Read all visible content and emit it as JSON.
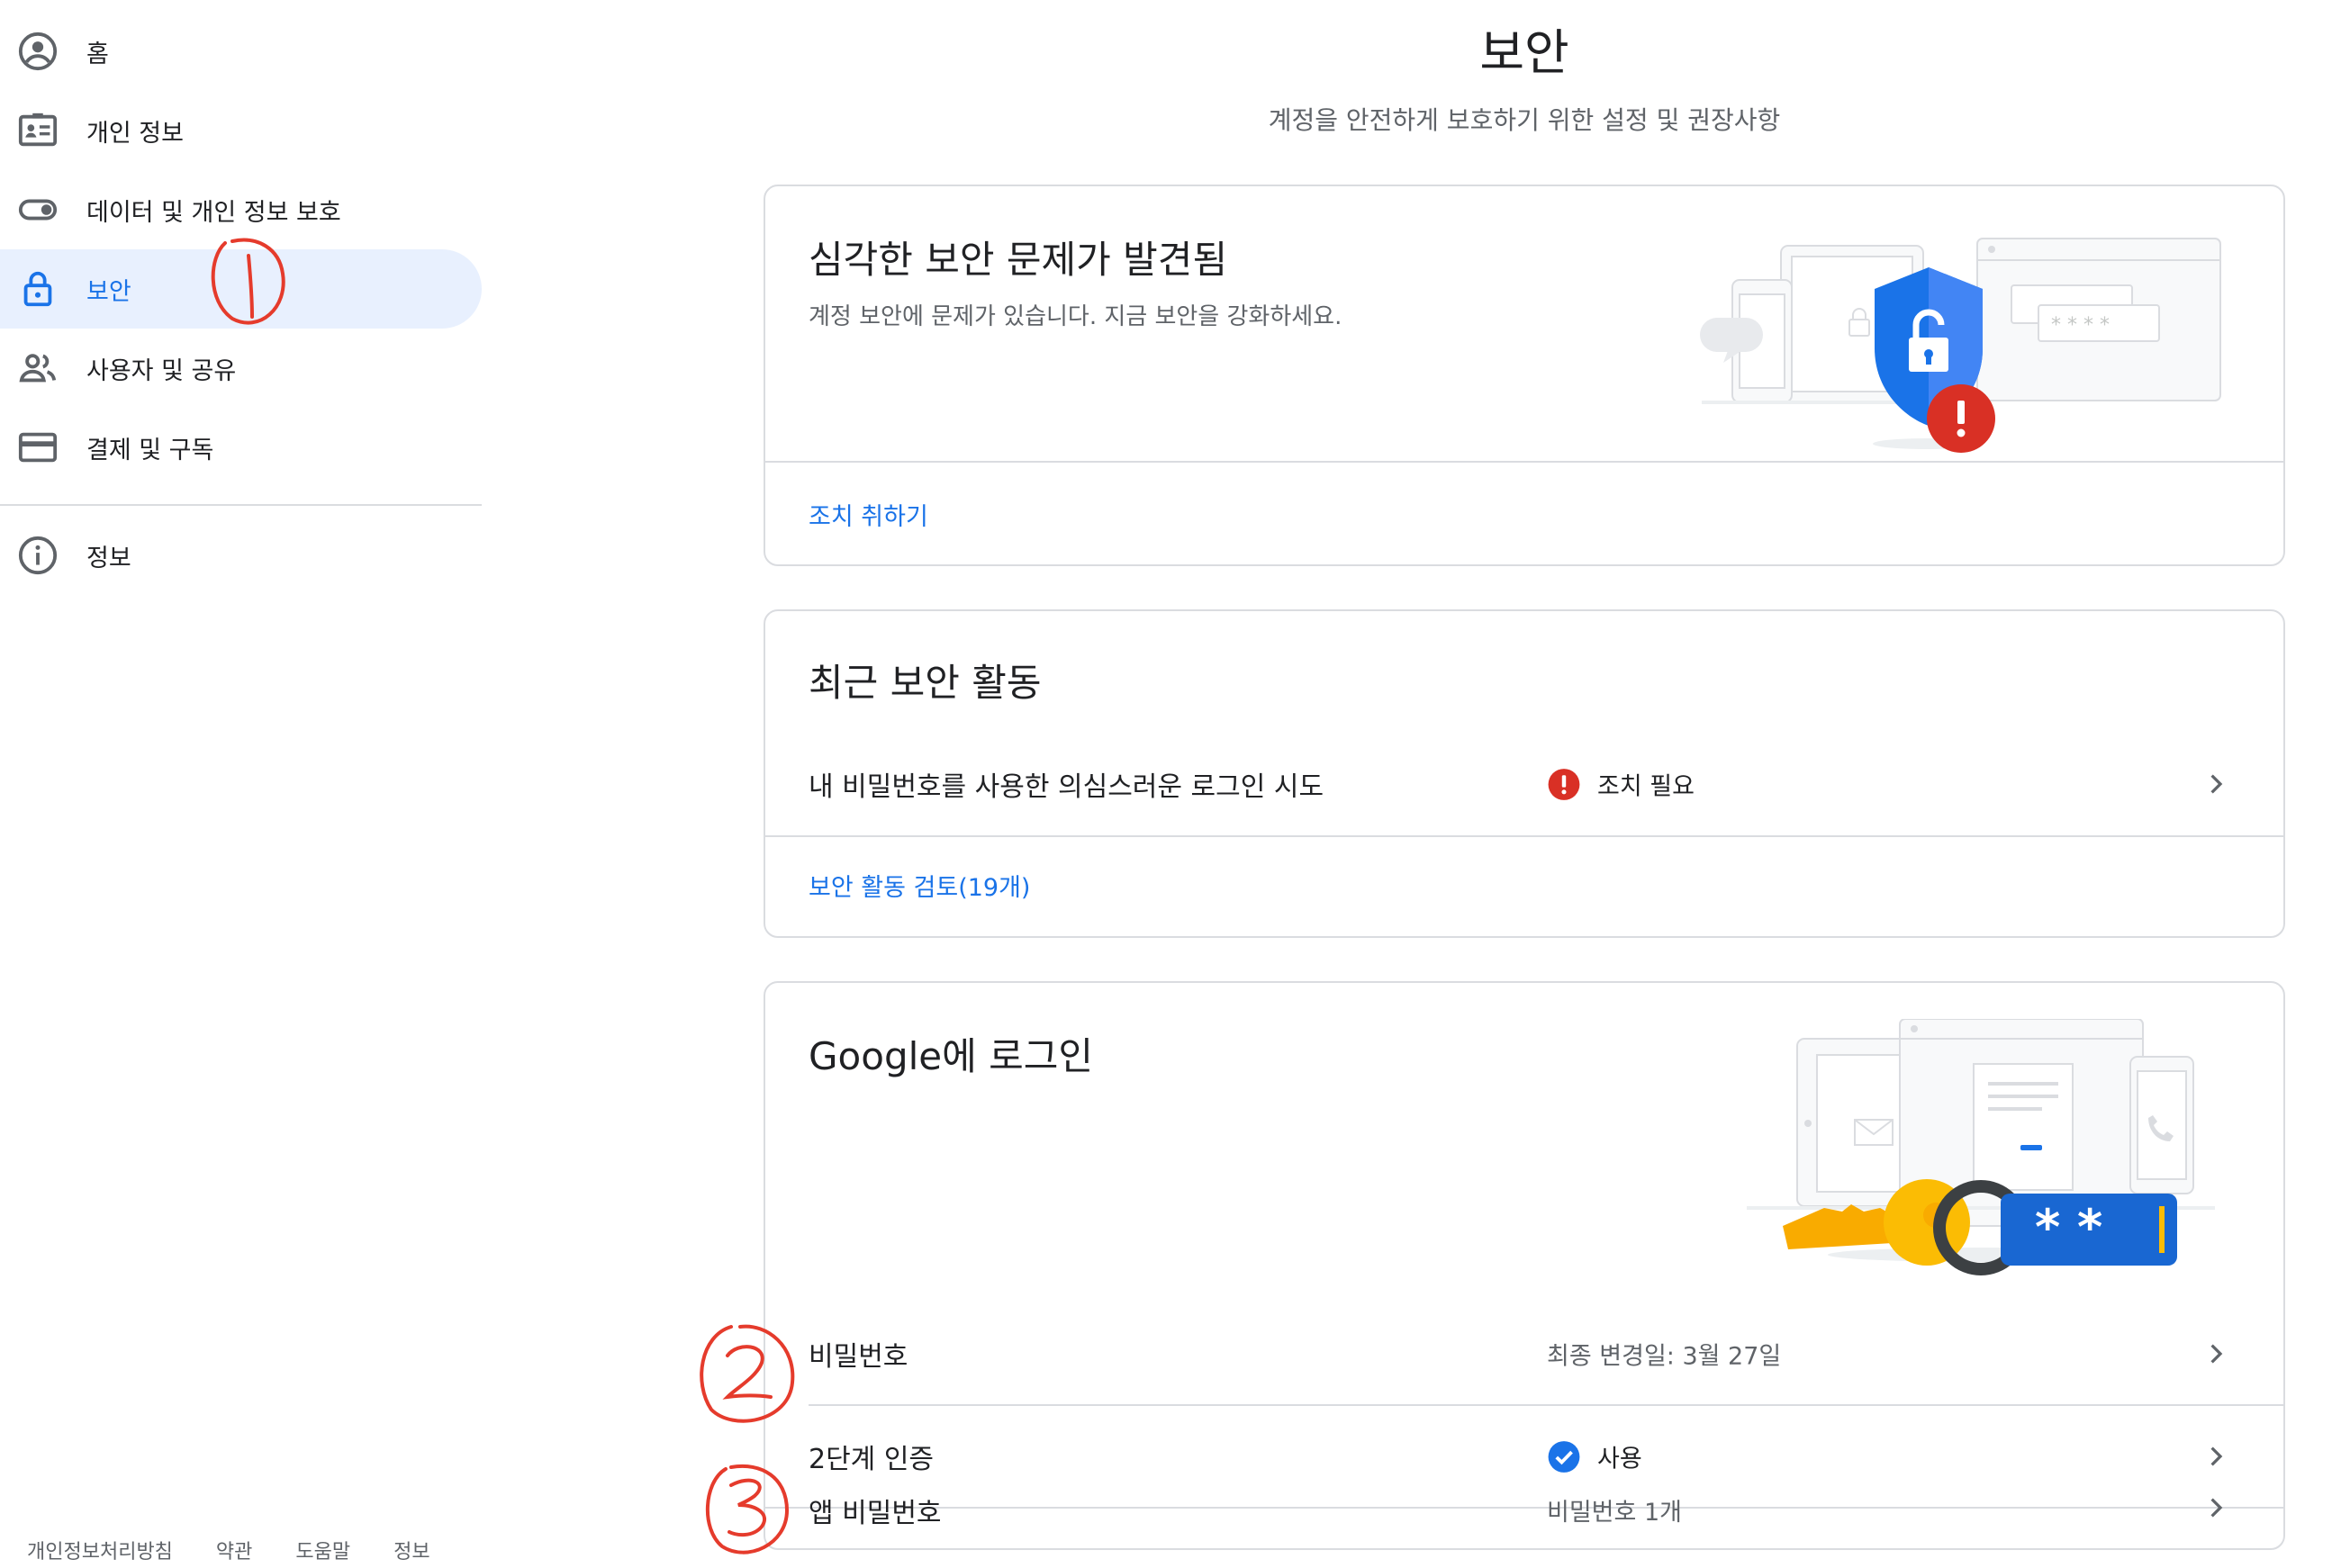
{
  "sidebar": {
    "items": [
      {
        "label": "홈",
        "icon": "account-circle-icon"
      },
      {
        "label": "개인 정보",
        "icon": "id-card-icon"
      },
      {
        "label": "데이터 및 개인 정보 보호",
        "icon": "toggle-icon"
      },
      {
        "label": "보안",
        "icon": "lock-icon",
        "active": true
      },
      {
        "label": "사용자 및 공유",
        "icon": "people-icon"
      },
      {
        "label": "결제 및 구독",
        "icon": "credit-card-icon"
      },
      {
        "label": "정보",
        "icon": "info-icon"
      }
    ]
  },
  "footer": {
    "privacy": "개인정보처리방침",
    "terms": "약관",
    "help": "도움말",
    "about": "정보"
  },
  "header": {
    "title": "보안",
    "subtitle": "계정을 안전하게 보호하기 위한 설정 및 권장사항"
  },
  "issue_card": {
    "title": "심각한 보안 문제가 발견됨",
    "description": "계정 보안에 문제가 있습니다. 지금 보안을 강화하세요.",
    "action_link": "조치 취하기",
    "password_mask": "* * * *"
  },
  "activity_card": {
    "title": "최근 보안 활동",
    "row_label": "내 비밀번호를 사용한 의심스러운 로그인 시도",
    "row_status": "조치 필요",
    "review_link": "보안 활동 검토(19개)"
  },
  "signin_card": {
    "title": "Google에 로그인",
    "password_mask": "* *",
    "rows": [
      {
        "label": "비밀번호",
        "value": "최종 변경일: 3월 27일"
      },
      {
        "label": "2단계 인증",
        "value": "사용"
      },
      {
        "label": "앱 비밀번호",
        "value": "비밀번호 1개"
      }
    ]
  },
  "colors": {
    "accent": "#1a73e8",
    "active_bg": "#e8f0fe",
    "warning": "#d93025",
    "annotation": "#e53b2c"
  }
}
